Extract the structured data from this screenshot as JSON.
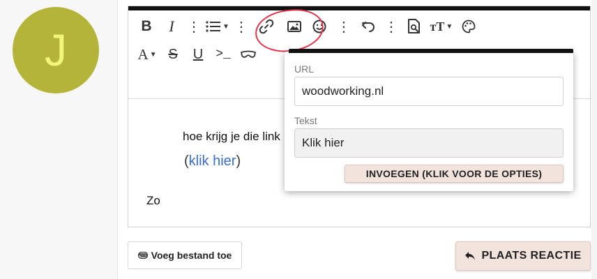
{
  "user": {
    "avatar_initial": "J",
    "avatar_color": "#b4b33a"
  },
  "toolbar": {
    "row1": [
      "bold-icon",
      "italic-icon",
      "more-icon",
      "list-icon",
      "more-icon",
      "link-icon",
      "image-icon",
      "emoji-icon",
      "more-icon",
      "undo-icon",
      "more-icon",
      "find-icon",
      "text-size-icon",
      "palette-icon"
    ],
    "row2": [
      "font-icon",
      "strikethrough-icon",
      "underline-icon",
      "code-icon",
      "spoiler-icon"
    ]
  },
  "content": {
    "line1": "hoe krijg je die link",
    "line2_open": "(",
    "line2_link": "klik hier",
    "line2_close": ")",
    "line3": "Zo"
  },
  "link_popup": {
    "url_label": "URL",
    "url_value": "woodworking.nl",
    "text_label": "Tekst",
    "text_value": "Klik hier",
    "insert_label": "INVOEGEN (KLIK VOOR DE OPTIES)"
  },
  "actions": {
    "attach_label": "Voeg bestand toe",
    "post_label": "PLAATS REACTIE"
  },
  "colors": {
    "accent_button": "#f2e3dd",
    "link": "#3b6ec4",
    "annotation": "#e0334a"
  }
}
